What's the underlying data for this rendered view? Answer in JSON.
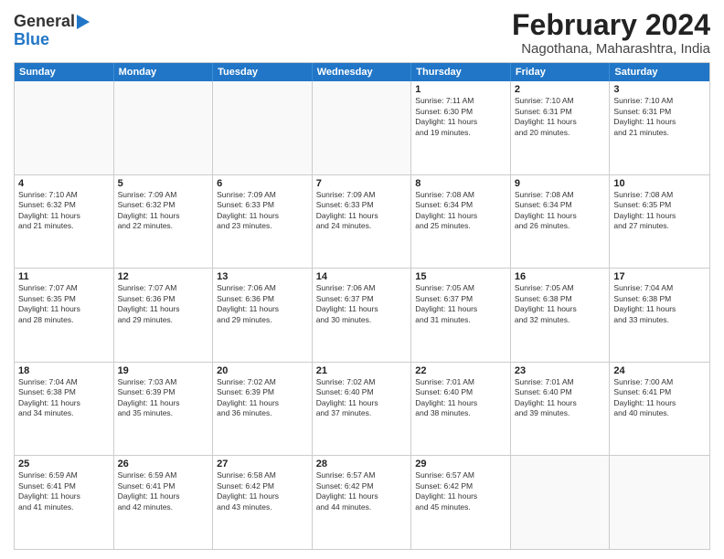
{
  "header": {
    "logo_line1": "General",
    "logo_line2": "Blue",
    "month_title": "February 2024",
    "location": "Nagothana, Maharashtra, India"
  },
  "days_of_week": [
    "Sunday",
    "Monday",
    "Tuesday",
    "Wednesday",
    "Thursday",
    "Friday",
    "Saturday"
  ],
  "weeks": [
    [
      {
        "day": "",
        "text": ""
      },
      {
        "day": "",
        "text": ""
      },
      {
        "day": "",
        "text": ""
      },
      {
        "day": "",
        "text": ""
      },
      {
        "day": "1",
        "text": "Sunrise: 7:11 AM\nSunset: 6:30 PM\nDaylight: 11 hours\nand 19 minutes."
      },
      {
        "day": "2",
        "text": "Sunrise: 7:10 AM\nSunset: 6:31 PM\nDaylight: 11 hours\nand 20 minutes."
      },
      {
        "day": "3",
        "text": "Sunrise: 7:10 AM\nSunset: 6:31 PM\nDaylight: 11 hours\nand 21 minutes."
      }
    ],
    [
      {
        "day": "4",
        "text": "Sunrise: 7:10 AM\nSunset: 6:32 PM\nDaylight: 11 hours\nand 21 minutes."
      },
      {
        "day": "5",
        "text": "Sunrise: 7:09 AM\nSunset: 6:32 PM\nDaylight: 11 hours\nand 22 minutes."
      },
      {
        "day": "6",
        "text": "Sunrise: 7:09 AM\nSunset: 6:33 PM\nDaylight: 11 hours\nand 23 minutes."
      },
      {
        "day": "7",
        "text": "Sunrise: 7:09 AM\nSunset: 6:33 PM\nDaylight: 11 hours\nand 24 minutes."
      },
      {
        "day": "8",
        "text": "Sunrise: 7:08 AM\nSunset: 6:34 PM\nDaylight: 11 hours\nand 25 minutes."
      },
      {
        "day": "9",
        "text": "Sunrise: 7:08 AM\nSunset: 6:34 PM\nDaylight: 11 hours\nand 26 minutes."
      },
      {
        "day": "10",
        "text": "Sunrise: 7:08 AM\nSunset: 6:35 PM\nDaylight: 11 hours\nand 27 minutes."
      }
    ],
    [
      {
        "day": "11",
        "text": "Sunrise: 7:07 AM\nSunset: 6:35 PM\nDaylight: 11 hours\nand 28 minutes."
      },
      {
        "day": "12",
        "text": "Sunrise: 7:07 AM\nSunset: 6:36 PM\nDaylight: 11 hours\nand 29 minutes."
      },
      {
        "day": "13",
        "text": "Sunrise: 7:06 AM\nSunset: 6:36 PM\nDaylight: 11 hours\nand 29 minutes."
      },
      {
        "day": "14",
        "text": "Sunrise: 7:06 AM\nSunset: 6:37 PM\nDaylight: 11 hours\nand 30 minutes."
      },
      {
        "day": "15",
        "text": "Sunrise: 7:05 AM\nSunset: 6:37 PM\nDaylight: 11 hours\nand 31 minutes."
      },
      {
        "day": "16",
        "text": "Sunrise: 7:05 AM\nSunset: 6:38 PM\nDaylight: 11 hours\nand 32 minutes."
      },
      {
        "day": "17",
        "text": "Sunrise: 7:04 AM\nSunset: 6:38 PM\nDaylight: 11 hours\nand 33 minutes."
      }
    ],
    [
      {
        "day": "18",
        "text": "Sunrise: 7:04 AM\nSunset: 6:38 PM\nDaylight: 11 hours\nand 34 minutes."
      },
      {
        "day": "19",
        "text": "Sunrise: 7:03 AM\nSunset: 6:39 PM\nDaylight: 11 hours\nand 35 minutes."
      },
      {
        "day": "20",
        "text": "Sunrise: 7:02 AM\nSunset: 6:39 PM\nDaylight: 11 hours\nand 36 minutes."
      },
      {
        "day": "21",
        "text": "Sunrise: 7:02 AM\nSunset: 6:40 PM\nDaylight: 11 hours\nand 37 minutes."
      },
      {
        "day": "22",
        "text": "Sunrise: 7:01 AM\nSunset: 6:40 PM\nDaylight: 11 hours\nand 38 minutes."
      },
      {
        "day": "23",
        "text": "Sunrise: 7:01 AM\nSunset: 6:40 PM\nDaylight: 11 hours\nand 39 minutes."
      },
      {
        "day": "24",
        "text": "Sunrise: 7:00 AM\nSunset: 6:41 PM\nDaylight: 11 hours\nand 40 minutes."
      }
    ],
    [
      {
        "day": "25",
        "text": "Sunrise: 6:59 AM\nSunset: 6:41 PM\nDaylight: 11 hours\nand 41 minutes."
      },
      {
        "day": "26",
        "text": "Sunrise: 6:59 AM\nSunset: 6:41 PM\nDaylight: 11 hours\nand 42 minutes."
      },
      {
        "day": "27",
        "text": "Sunrise: 6:58 AM\nSunset: 6:42 PM\nDaylight: 11 hours\nand 43 minutes."
      },
      {
        "day": "28",
        "text": "Sunrise: 6:57 AM\nSunset: 6:42 PM\nDaylight: 11 hours\nand 44 minutes."
      },
      {
        "day": "29",
        "text": "Sunrise: 6:57 AM\nSunset: 6:42 PM\nDaylight: 11 hours\nand 45 minutes."
      },
      {
        "day": "",
        "text": ""
      },
      {
        "day": "",
        "text": ""
      }
    ]
  ]
}
